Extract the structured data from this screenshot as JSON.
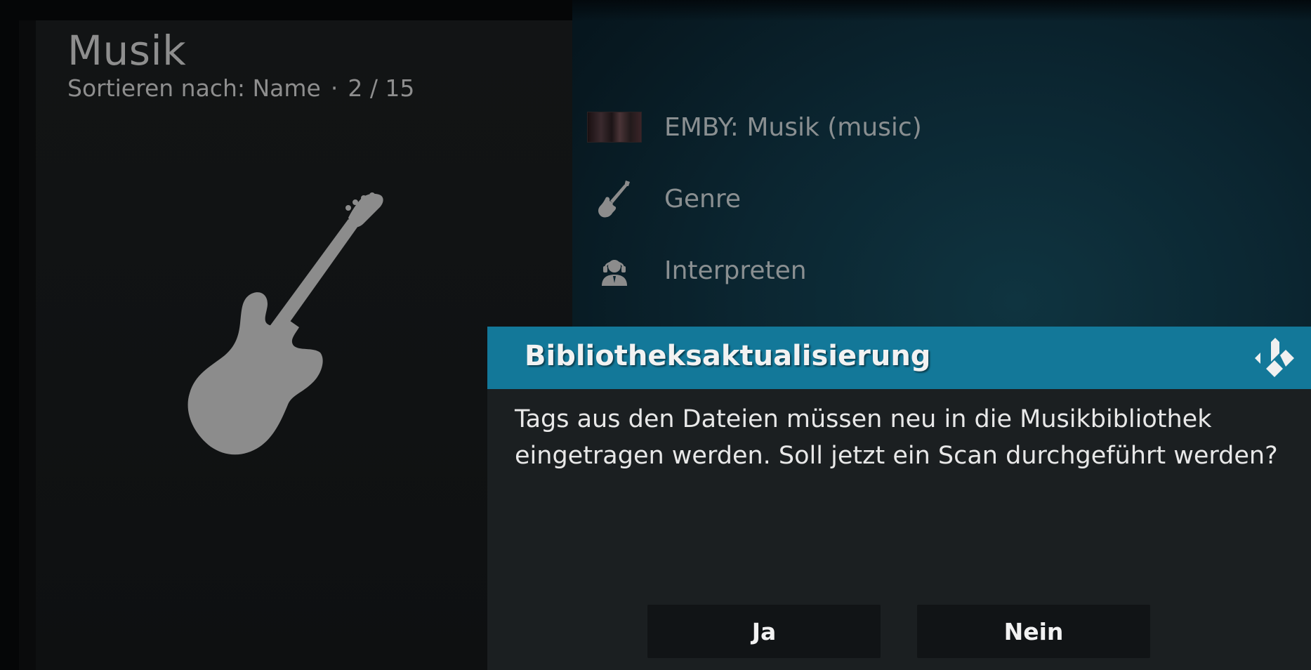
{
  "header": {
    "title": "Musik",
    "sort_label": "Sortieren nach: Name",
    "separator": "·",
    "position": "2 / 15"
  },
  "artwork": {
    "icon": "bass-guitar-icon"
  },
  "media_list": {
    "items": [
      {
        "label": "EMBY: Musik (music)",
        "icon": "emby-thumbnail"
      },
      {
        "label": "Genre",
        "icon": "guitar-icon"
      },
      {
        "label": "Interpreten",
        "icon": "artist-icon"
      }
    ]
  },
  "dialog": {
    "title": "Bibliotheksaktualisierung",
    "logo": "kodi-logo-icon",
    "message_line1": "Tags aus den Dateien müssen neu in die Musikbibliothek",
    "message_line2": "eingetragen werden. Soll jetzt ein Scan durchgeführt werden?",
    "yes_label": "Ja",
    "no_label": "Nein"
  },
  "colors": {
    "dialog_header": "#137899",
    "dialog_body": "#1b1f21",
    "button_bg": "#111416",
    "text_muted": "#8e8e8e"
  }
}
